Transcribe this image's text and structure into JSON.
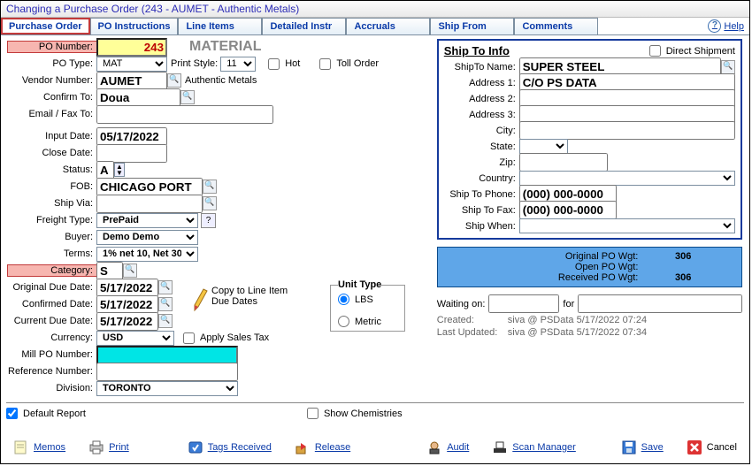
{
  "title": "Changing a Purchase Order  (243 - AUMET - Authentic Metals)",
  "tabs": {
    "t0": "Purchase Order",
    "t1": "PO Instructions",
    "t2": "Line Items",
    "t3": "Detailed Instr",
    "t4": "Accruals",
    "t5": "Ship From",
    "t6": "Comments"
  },
  "help": "Help",
  "left": {
    "po_number_lbl": "PO Number:",
    "po_number": "243",
    "po_type_lbl": "PO Type:",
    "po_type": "MAT",
    "print_style_lbl": "Print Style:",
    "print_style": "11",
    "hot_lbl": "Hot",
    "toll_lbl": "Toll Order",
    "material_title": "MATERIAL",
    "vendor_lbl": "Vendor Number:",
    "vendor": "AUMET",
    "auth_metals": "Authentic Metals",
    "confirm_lbl": "Confirm To:",
    "confirm": "Doua",
    "emailfax_lbl": "Email / Fax To:",
    "input_date_lbl": "Input Date:",
    "input_date": "05/17/2022",
    "close_date_lbl": "Close Date:",
    "status_lbl": "Status:",
    "status": "A",
    "fob_lbl": "FOB:",
    "fob": "CHICAGO PORT",
    "shipvia_lbl": "Ship Via:",
    "freight_lbl": "Freight Type:",
    "freight": "PrePaid",
    "q": "?",
    "buyer_lbl": "Buyer:",
    "buyer": "Demo Demo",
    "terms_lbl": "Terms:",
    "terms": "1% net 10, Net 30",
    "category_lbl": "Category:",
    "category": "S",
    "orig_due_lbl": "Original Due Date:",
    "orig_due": "5/17/2022",
    "conf_due_lbl": "Confirmed Date:",
    "conf_due": "5/17/2022",
    "curr_due_lbl": "Current Due Date:",
    "curr_due": "5/17/2022",
    "currency_lbl": "Currency:",
    "currency": "USD",
    "apply_tax": "Apply Sales Tax",
    "mill_lbl": "Mill PO Number:",
    "ref_lbl": "Reference Number:",
    "division_lbl": "Division:",
    "division": "TORONTO",
    "copy_lbl1": "Copy to Line Item",
    "copy_lbl2": "Due Dates",
    "unit_title": "Unit Type",
    "unit_lbs": "LBS",
    "unit_metric": "Metric"
  },
  "ship": {
    "header": "Ship To Info",
    "direct": "Direct Shipment",
    "name_lbl": "ShipTo Name:",
    "name": "SUPER STEEL",
    "addr1_lbl": "Address 1:",
    "addr1": "C/O PS DATA",
    "addr2_lbl": "Address 2:",
    "addr3_lbl": "Address 3:",
    "city_lbl": "City:",
    "state_lbl": "State:",
    "zip_lbl": "Zip:",
    "country_lbl": "Country:",
    "phone_lbl": "Ship To Phone:",
    "phone": "(000) 000-0000",
    "fax_lbl": "Ship To Fax:",
    "fax": "(000) 000-0000",
    "when_lbl": "Ship When:"
  },
  "wgt": {
    "orig_k": "Original PO Wgt:",
    "orig_v": "306",
    "open_k": "Open PO Wgt:",
    "open_v": "",
    "recv_k": "Received PO Wgt:",
    "recv_v": "306"
  },
  "wait": {
    "waiting": "Waiting on:",
    "for": "for"
  },
  "meta": {
    "created_k": "Created:",
    "created_v": "siva @ PSData 5/17/2022 07:24",
    "updated_k": "Last Updated:",
    "updated_v": "siva @ PSData 5/17/2022 07:34"
  },
  "footer": {
    "default_report": "Default Report",
    "show_chem": "Show Chemistries",
    "memos": "Memos",
    "print": "Print",
    "tags": "Tags Received",
    "release": "Release",
    "audit": "Audit",
    "scan": "Scan Manager",
    "save": "Save",
    "cancel": "Cancel"
  }
}
